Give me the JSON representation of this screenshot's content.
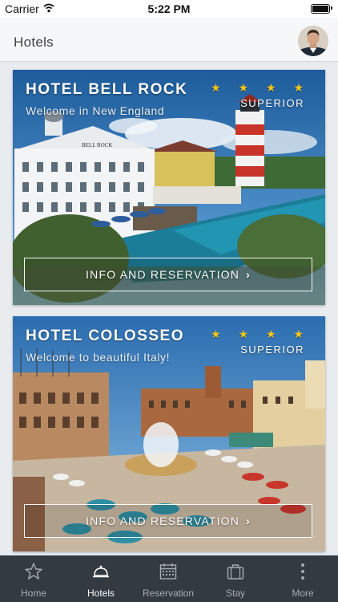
{
  "status": {
    "carrier": "Carrier",
    "time": "5:22 PM"
  },
  "header": {
    "title": "Hotels"
  },
  "hotels": [
    {
      "name": "HOTEL BELL ROCK",
      "subtitle": "Welcome in New England",
      "stars": "★ ★ ★ ★",
      "category": "SUPERIOR",
      "button": "INFO AND RESERVATION",
      "image_text": "BELL ROCK"
    },
    {
      "name": "HOTEL COLOSSEO",
      "subtitle": "Welcome to beautiful Italy!",
      "stars": "★ ★ ★ ★",
      "category": "SUPERIOR",
      "button": "INFO AND RESERVATION"
    }
  ],
  "tabs": [
    {
      "label": "Home",
      "icon": "star-icon"
    },
    {
      "label": "Hotels",
      "icon": "bell-icon"
    },
    {
      "label": "Reservation",
      "icon": "calendar-icon"
    },
    {
      "label": "Stay",
      "icon": "suitcase-icon"
    },
    {
      "label": "More",
      "icon": "more-icon"
    }
  ],
  "colors": {
    "tabbar": "#333a40",
    "star": "#f5c518",
    "active_tab": "#ffffff"
  }
}
